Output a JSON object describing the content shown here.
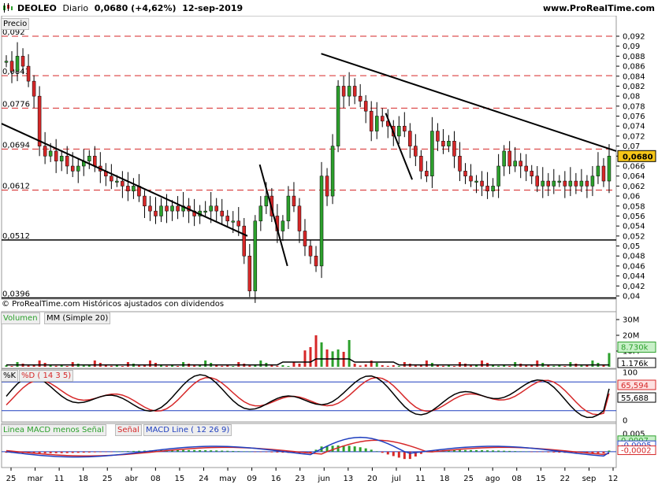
{
  "header": {
    "ticker": "DEOLEO",
    "period": "Diario",
    "last_change": "0,0680 (+4,62%)",
    "date": "12-sep-2019",
    "site": "www.ProRealTime.com"
  },
  "price_panel": {
    "label": "Precio",
    "copyright": "© ProRealTime.com  Históricos ajustados con dividendos",
    "right_ticks": [
      "0,092",
      "0,09",
      "0,088",
      "0,086",
      "0,084",
      "0,082",
      "0,08",
      "0,078",
      "0,076",
      "0,074",
      "0,072",
      "0,07",
      "0,068",
      "0,066",
      "0,064",
      "0,062",
      "0,06",
      "0,058",
      "0,056",
      "0,054",
      "0,052",
      "0,05",
      "0,048",
      "0,046",
      "0,044",
      "0,042",
      "0,04"
    ],
    "last_price_badge": "0,0680",
    "left_level_labels": [
      "0,092",
      "0,0841",
      "0,0776",
      "0,0694",
      "0,0612",
      "0,0512",
      "0,0396"
    ],
    "badge_color": "#f5c518"
  },
  "volume_panel": {
    "label": "Volumen",
    "label2": "MM (Simple 20)",
    "right_ticks": [
      "30M",
      "20M",
      "10M"
    ],
    "badge_volume": "8.730k",
    "badge_mm": "1.176k"
  },
  "stoch_panel": {
    "label1": "%K",
    "label2": "%D ( 14 3 5)",
    "right_ticks": [
      "100",
      "0"
    ],
    "badge_k": "65,594",
    "badge_d": "55,688"
  },
  "macd_panel": {
    "label1": "Linea MACD menos Señal",
    "label2": "Señal",
    "label3": "MACD Line ( 12 26 9)",
    "right_ticks": [
      "0,005",
      "-0"
    ],
    "badge_hist": "0,0007",
    "badge_signal": "-0,0005",
    "badge_macd": "-0,0002"
  },
  "x_axis": {
    "labels": [
      "25",
      "mar",
      "11",
      "18",
      "25",
      "abr",
      "08",
      "15",
      "24",
      "may",
      "09",
      "16",
      "23",
      "jun",
      "13",
      "20",
      "jul",
      "11",
      "18",
      "25",
      "ago",
      "08",
      "15",
      "22",
      "sep",
      "12"
    ]
  },
  "chart_data": {
    "type": "candlestick",
    "title": "DEOLEO Diario",
    "ylim": [
      0.04,
      0.092
    ],
    "horizontal_levels": [
      0.092,
      0.0841,
      0.0776,
      0.0694,
      0.0612,
      0.0512,
      0.0396
    ],
    "trendlines": [
      {
        "from": [
          0,
          0.0745
        ],
        "to": [
          0.4,
          0.052
        ]
      },
      {
        "from": [
          0.52,
          0.0885
        ],
        "to": [
          1.0,
          0.069
        ]
      },
      {
        "from": [
          0.42,
          0.0663
        ],
        "to": [
          0.465,
          0.046
        ]
      },
      {
        "from": [
          0.625,
          0.0766
        ],
        "to": [
          0.668,
          0.0633
        ]
      }
    ],
    "closes": [
      0.087,
      0.085,
      0.088,
      0.086,
      0.083,
      0.08,
      0.07,
      0.068,
      0.069,
      0.067,
      0.068,
      0.066,
      0.065,
      0.066,
      0.067,
      0.068,
      0.066,
      0.065,
      0.064,
      0.063,
      0.063,
      0.062,
      0.061,
      0.062,
      0.06,
      0.058,
      0.057,
      0.056,
      0.058,
      0.057,
      0.058,
      0.057,
      0.058,
      0.057,
      0.056,
      0.057,
      0.057,
      0.058,
      0.057,
      0.056,
      0.055,
      0.055,
      0.054,
      0.048,
      0.041,
      0.055,
      0.058,
      0.06,
      0.056,
      0.053,
      0.055,
      0.06,
      0.058,
      0.053,
      0.05,
      0.048,
      0.046,
      0.064,
      0.06,
      0.07,
      0.082,
      0.08,
      0.082,
      0.08,
      0.079,
      0.077,
      0.073,
      0.076,
      0.075,
      0.074,
      0.072,
      0.074,
      0.073,
      0.07,
      0.068,
      0.065,
      0.064,
      0.073,
      0.071,
      0.07,
      0.071,
      0.068,
      0.065,
      0.064,
      0.063,
      0.063,
      0.062,
      0.061,
      0.062,
      0.066,
      0.069,
      0.066,
      0.067,
      0.066,
      0.065,
      0.064,
      0.062,
      0.063,
      0.062,
      0.063,
      0.063,
      0.062,
      0.063,
      0.062,
      0.063,
      0.062,
      0.064,
      0.066,
      0.063,
      0.068
    ],
    "volume": {
      "right_ticks": [
        30,
        20,
        10
      ],
      "unit": "M",
      "last": 8.73,
      "mm20": 1.176
    },
    "stochastic": {
      "k_last": 65.594,
      "d_last": 55.688
    },
    "macd": {
      "hist_last": 0.0007,
      "signal_last": -0.0005,
      "macd_last": -0.0002
    }
  }
}
